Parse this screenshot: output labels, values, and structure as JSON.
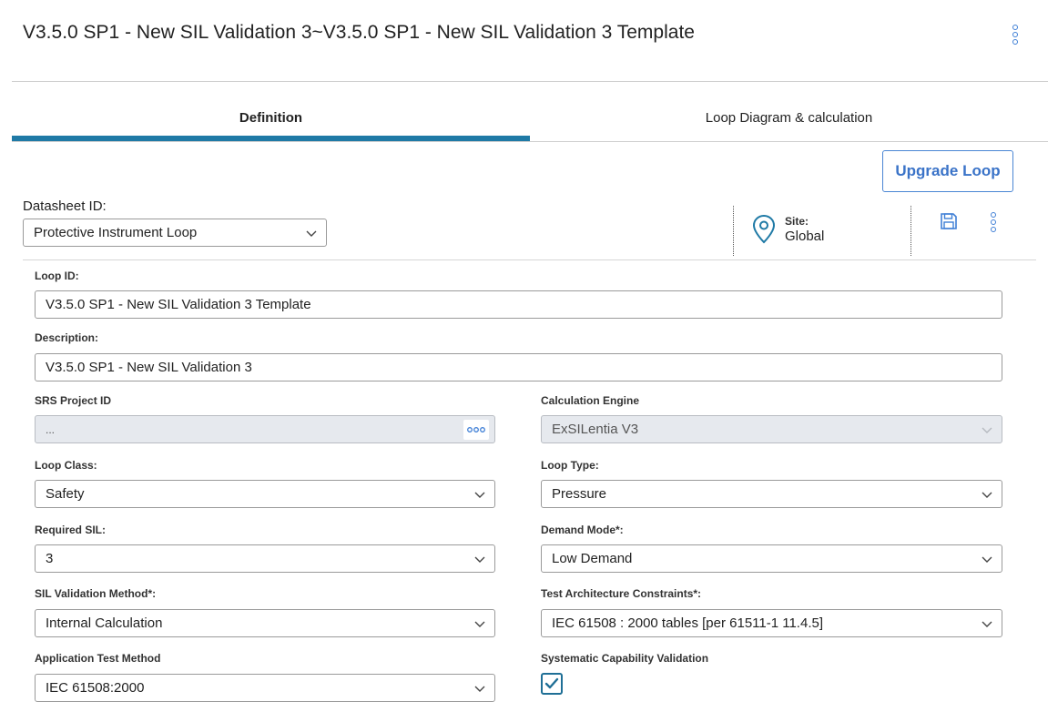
{
  "header": {
    "title": "V3.5.0 SP1 - New SIL Validation 3~V3.5.0 SP1 - New SIL Validation 3 Template",
    "menu_icon": "kebab-vertical-icon"
  },
  "tabs": [
    {
      "label": "Definition",
      "active": true
    },
    {
      "label": "Loop Diagram & calculation",
      "active": false
    }
  ],
  "toolbar": {
    "upgrade_label": "Upgrade Loop",
    "save_icon": "floppy-save-icon",
    "more_icon": "kebab-vertical-icon"
  },
  "datasheet": {
    "label": "Datasheet ID:",
    "value": "Protective Instrument Loop"
  },
  "site": {
    "label": "Site:",
    "value": "Global",
    "icon": "map-pin-icon"
  },
  "form": {
    "loop_id": {
      "label": "Loop ID:",
      "value": "V3.5.0 SP1 - New SIL Validation  3 Template"
    },
    "description": {
      "label": "Description:",
      "value": "V3.5.0 SP1 - New SIL Validation  3"
    },
    "srs_project_id": {
      "label": "SRS Project ID",
      "value": "..."
    },
    "calculation_engine": {
      "label": "Calculation Engine",
      "value": "ExSILentia V3"
    },
    "loop_class": {
      "label": "Loop Class:",
      "value": "Safety"
    },
    "loop_type": {
      "label": "Loop Type:",
      "value": "Pressure"
    },
    "required_sil": {
      "label": "Required SIL:",
      "value": "3"
    },
    "demand_mode": {
      "label": "Demand Mode*:",
      "value": "Low Demand"
    },
    "sil_validation_method": {
      "label": "SIL Validation Method*:",
      "value": "Internal Calculation"
    },
    "test_architecture": {
      "label": "Test Architecture Constraints*:",
      "value": "IEC 61508 : 2000 tables [per 61511-1 11.4.5]"
    },
    "application_test_method": {
      "label": "Application Test Method",
      "value": "IEC 61508:2000"
    },
    "systematic_capability": {
      "label": "Systematic Capability Validation",
      "checked": true
    }
  },
  "colors": {
    "accent": "#1f7aa6",
    "link_blue": "#3a73c8"
  }
}
